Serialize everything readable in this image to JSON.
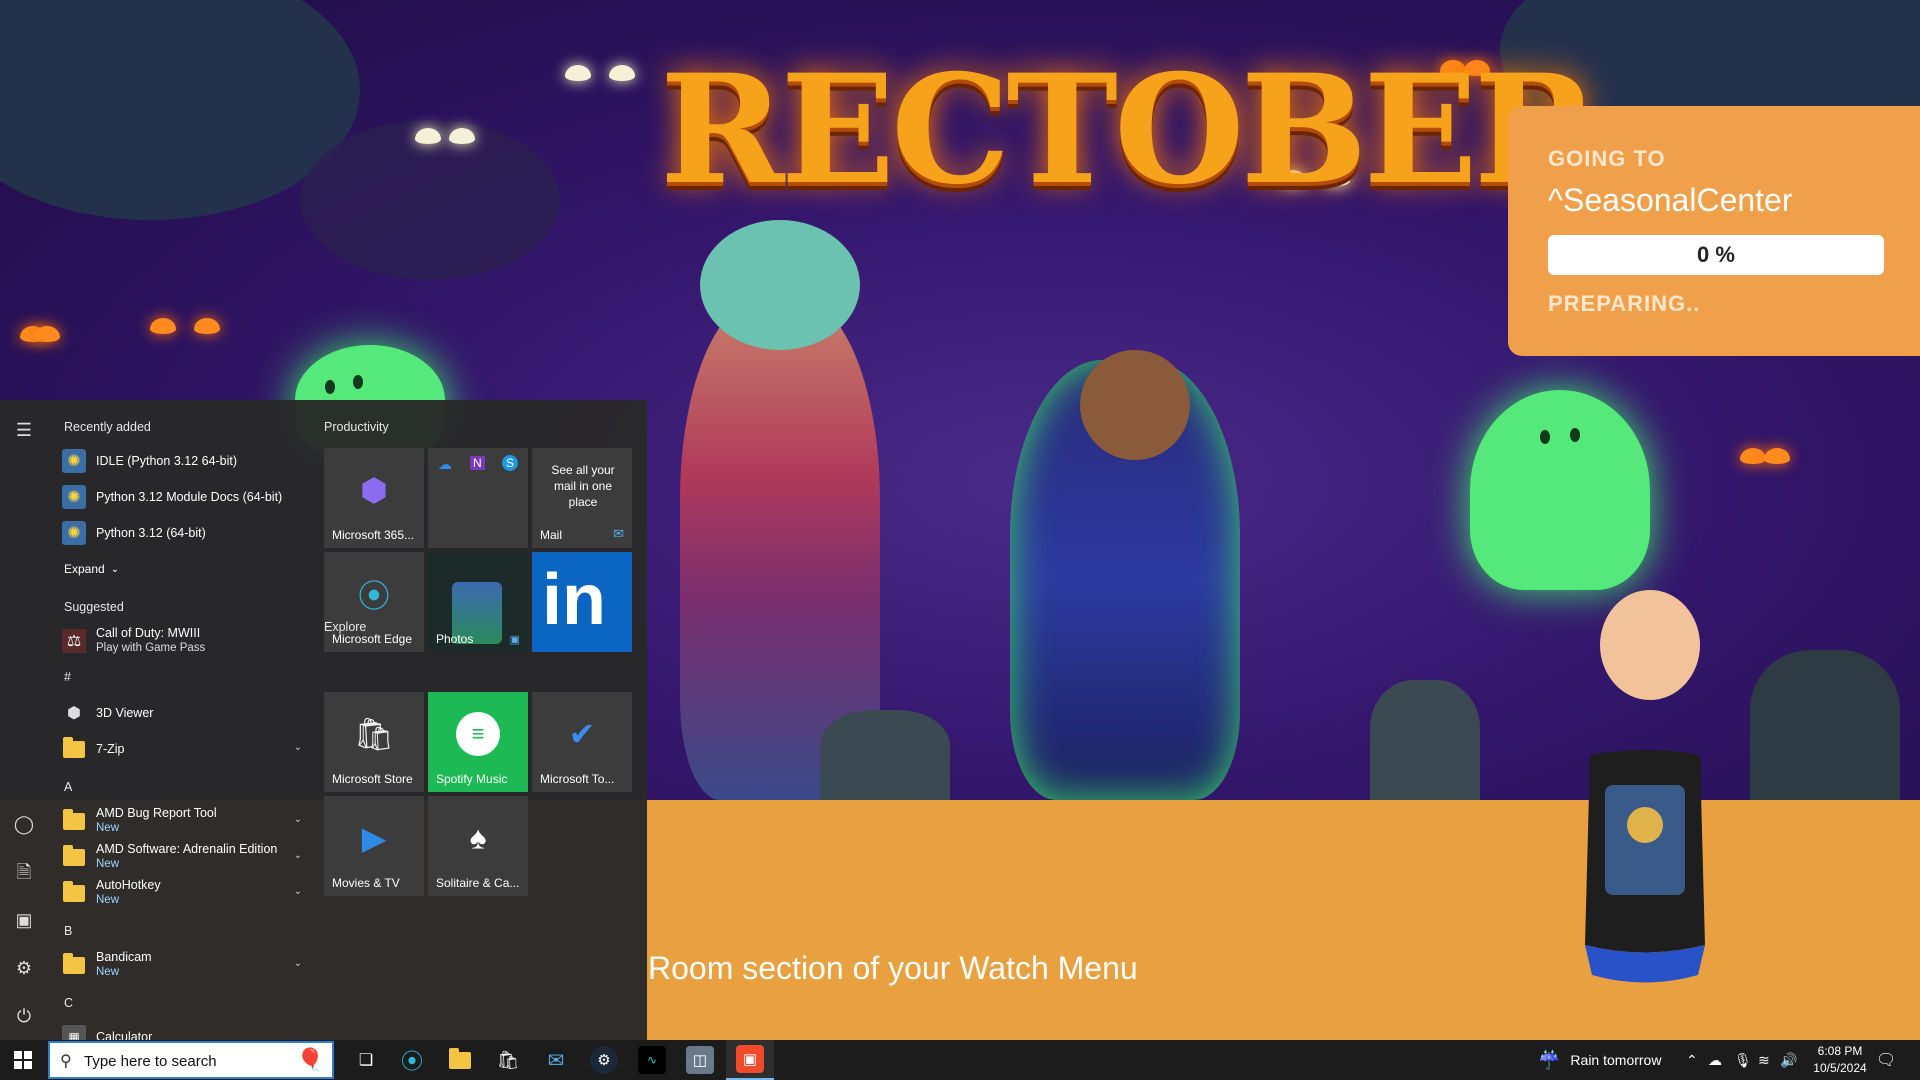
{
  "game": {
    "title_art": "RECTOBER",
    "loading": {
      "going_label": "GOING TO",
      "destination": "^SeasonalCenter",
      "progress_text": "0 %",
      "progress_fraction": 0,
      "status": "PREPARING.."
    },
    "banner_text": "Room section of your Watch Menu"
  },
  "start_menu": {
    "recently_added_label": "Recently added",
    "recent": [
      {
        "label": "IDLE (Python 3.12 64-bit)"
      },
      {
        "label": "Python 3.12 Module Docs (64-bit)"
      },
      {
        "label": "Python 3.12 (64-bit)"
      }
    ],
    "expand_label": "Expand",
    "suggested_label": "Suggested",
    "suggested": {
      "title": "Call of Duty: MWIII",
      "subtitle": "Play with Game Pass"
    },
    "letters": {
      "hash": "#",
      "a": "A",
      "b": "B",
      "c": "C"
    },
    "apps": {
      "viewer": "3D Viewer",
      "zip": "7-Zip",
      "amd_bug": "AMD Bug Report Tool",
      "amd_software": "AMD Software: Adrenalin Edition",
      "autohotkey": "AutoHotkey",
      "bandicam": "Bandicam",
      "calculator": "Calculator",
      "new_badge": "New"
    },
    "groups": {
      "productivity": "Productivity",
      "explore": "Explore"
    },
    "tiles": {
      "m365": "Microsoft 365...",
      "mail_blurb": "See all your mail in one place",
      "mail": "Mail",
      "edge": "Microsoft Edge",
      "photos": "Photos",
      "linkedin": "in",
      "store": "Microsoft Store",
      "spotify": "Spotify Music",
      "todo": "Microsoft To...",
      "movies": "Movies & TV",
      "solitaire": "Solitaire & Ca..."
    }
  },
  "taskbar": {
    "search_placeholder": "Type here to search",
    "weather": "Rain tomorrow",
    "time": "6:08 PM",
    "date": "10/5/2024"
  },
  "colors": {
    "accent": "#2d7fd3",
    "orange_panel": "#f0a04a",
    "banner": "#e8a040",
    "spotify": "#1db954",
    "linkedin": "#0a66c2"
  }
}
